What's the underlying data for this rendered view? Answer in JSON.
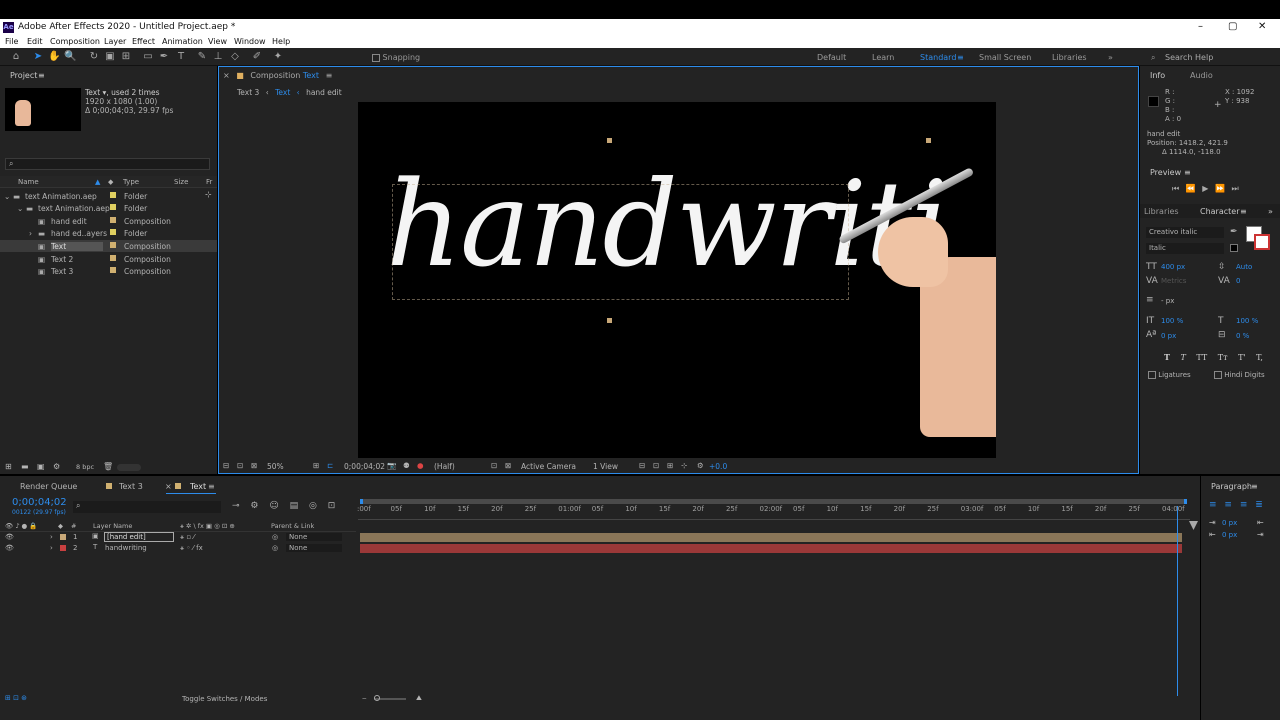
{
  "window": {
    "title": "Adobe After Effects 2020 - Untitled Project.aep *",
    "logo": "Ae"
  },
  "menu": [
    "File",
    "Edit",
    "Composition",
    "Layer",
    "Effect",
    "Animation",
    "View",
    "Window",
    "Help"
  ],
  "toolbar": {
    "snapping": "Snapping",
    "workspaces": [
      "Default",
      "Learn",
      "Standard",
      "Small Screen",
      "Libraries"
    ],
    "search_placeholder": "Search Help"
  },
  "project": {
    "title": "Project",
    "thumb_name": "Text",
    "thumb_used": ", used 2 times",
    "thumb_size": "1920 x 1080 (1.00)",
    "thumb_dur": "Δ 0;00;04;03, 29.97 fps",
    "cols": [
      "Name",
      "Type",
      "Size",
      "Fr"
    ],
    "items": [
      {
        "name": "text Animation.aep",
        "type": "Folder",
        "color": "#e0d060",
        "indent": 0
      },
      {
        "name": "text Animation.aep",
        "type": "Folder",
        "color": "#e0d060",
        "indent": 1
      },
      {
        "name": "hand edit",
        "type": "Composition",
        "color": "#d0b070",
        "indent": 2
      },
      {
        "name": "hand ed..ayers",
        "type": "Folder",
        "color": "#e0d060",
        "indent": 2
      },
      {
        "name": "Text",
        "type": "Composition",
        "color": "#d0b070",
        "indent": 2
      },
      {
        "name": "Text 2",
        "type": "Composition",
        "color": "#d0b070",
        "indent": 2
      },
      {
        "name": "Text 3",
        "type": "Composition",
        "color": "#d0b070",
        "indent": 2
      }
    ],
    "bpc": "8 bpc"
  },
  "comp": {
    "tab_prefix": "Composition",
    "tab_name": "Text",
    "crumbs": [
      "Text 3",
      "Text",
      "hand edit"
    ],
    "word": "handwriti",
    "footer": {
      "zoom": "50%",
      "time": "0;00;04;02",
      "res": "(Half)",
      "camera": "Active Camera",
      "views": "1 View",
      "offset": "+0.0"
    }
  },
  "info": {
    "tabs": [
      "Info",
      "Audio"
    ],
    "r": "R :",
    "g": "G :",
    "b": "B :",
    "a": "A : 0",
    "x": "X : 1092",
    "y": "Y : 938",
    "layer": "hand edit",
    "pos": "Position: 1418.2, 421.9",
    "delta": "Δ 1114.0, -118.0"
  },
  "preview": {
    "title": "Preview"
  },
  "character": {
    "tabs": [
      "Libraries",
      "Character"
    ],
    "font": "Creativo italic",
    "style": "Italic",
    "size": "400 px",
    "leading": "Auto",
    "kern": "Metrics",
    "track": "0",
    "stroke": "- px",
    "vscale": "100 %",
    "hscale": "100 %",
    "baseline": "0 px",
    "tsume": "0 %",
    "styles": [
      "T",
      "T",
      "TT",
      "Tт",
      "T'",
      "T,"
    ],
    "ligatures": "Ligatures",
    "hindi": "Hindi Digits"
  },
  "timeline": {
    "tabs": [
      "Render Queue",
      "Text 3",
      "Text"
    ],
    "time": "0;00;04;02",
    "frames": "00122 (29.97 fps)",
    "cols": [
      "Layer Name",
      "Parent & Link"
    ],
    "layers": [
      {
        "num": "1",
        "name": "[hand edit]",
        "parent": "None",
        "color": "#c8a878"
      },
      {
        "num": "2",
        "name": "handwriting",
        "parent": "None",
        "color": "#c84040"
      }
    ],
    "ruler": [
      ":00f",
      "05f",
      "10f",
      "15f",
      "20f",
      "25f",
      "01:00f",
      "05f",
      "10f",
      "15f",
      "20f",
      "25f",
      "02:00f",
      "05f",
      "10f",
      "15f",
      "20f",
      "25f",
      "03:00f",
      "05f",
      "10f",
      "15f",
      "20f",
      "25f",
      "04:00f"
    ],
    "toggle": "Toggle Switches / Modes"
  },
  "paragraph": {
    "title": "Paragraph",
    "v1": "0 px",
    "v2": "0 px"
  },
  "colors": {
    "accent": "#2d8ceb",
    "panel": "#232323"
  }
}
